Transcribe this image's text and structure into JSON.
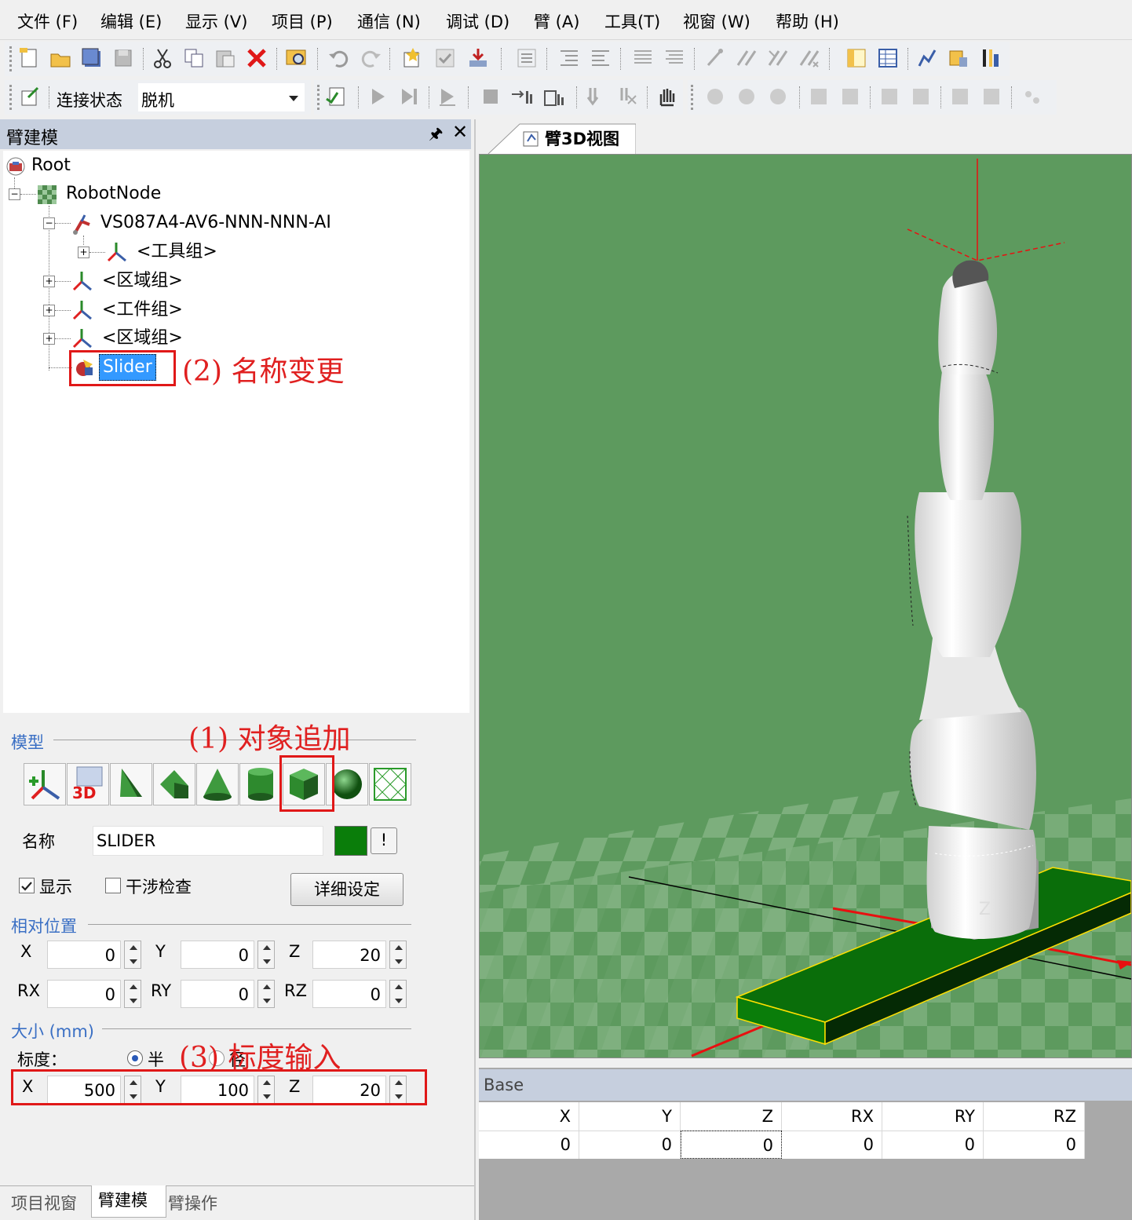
{
  "menu": [
    "文件 (F)",
    "编辑 (E)",
    "显示 (V)",
    "项目 (P)",
    "通信 (N)",
    "调试 (D)",
    "臂 (A)",
    "工具(T)",
    "视窗 (W)",
    "帮助 (H)"
  ],
  "toolbar2": {
    "connect_label": "连接状态",
    "connect_value": "脱机"
  },
  "left_panel": {
    "title": "臂建模",
    "tree": {
      "root": "Root",
      "robot_node": "RobotNode",
      "robot": "VS087A4-AV6-NNN-NNN-AI",
      "tool_group": "<工具组>",
      "area_group_1": "<区域组>",
      "work_group": "<工件组>",
      "area_group_2": "<区域组>",
      "slider": "Slider"
    },
    "annotations": {
      "rename": "(2) 名称变更",
      "add_object": "(1) 对象追加",
      "scale_input": "(3) 标度输入"
    },
    "model_section": "模型",
    "name_label": "名称",
    "name_value": "SLIDER",
    "color_hex": "#0a7d0a",
    "show_label": "显示",
    "show_checked": true,
    "interference_label": "干涉检查",
    "interference_checked": false,
    "detail_button": "详细设定",
    "rel_pos_section": "相对位置",
    "rel_pos": {
      "x_label": "X",
      "x": "0",
      "y_label": "Y",
      "y": "0",
      "z_label": "Z",
      "z": "20",
      "rx_label": "RX",
      "rx": "0",
      "ry_label": "RY",
      "ry": "0",
      "rz_label": "RZ",
      "rz": "0"
    },
    "size_section": "大小 (mm)",
    "scale_label": "标度：",
    "radio_half": "半",
    "radio_full": "径",
    "size": {
      "x_label": "X",
      "x": "500",
      "y_label": "Y",
      "y": "100",
      "z_label": "Z",
      "z": "20"
    },
    "tabs": [
      "项目视窗",
      "臂建模",
      "臂操作"
    ],
    "active_tab": 1
  },
  "view": {
    "tab": "臂3D视图",
    "axis_label": "Z",
    "background": "#5d9a5e",
    "robot_color": "#ffffff",
    "slider_color": "#0a6e0a"
  },
  "base_panel": {
    "title": "Base",
    "columns": [
      "X",
      "Y",
      "Z",
      "RX",
      "RY",
      "RZ"
    ],
    "values": [
      "0",
      "0",
      "0",
      "0",
      "0",
      "0"
    ]
  }
}
